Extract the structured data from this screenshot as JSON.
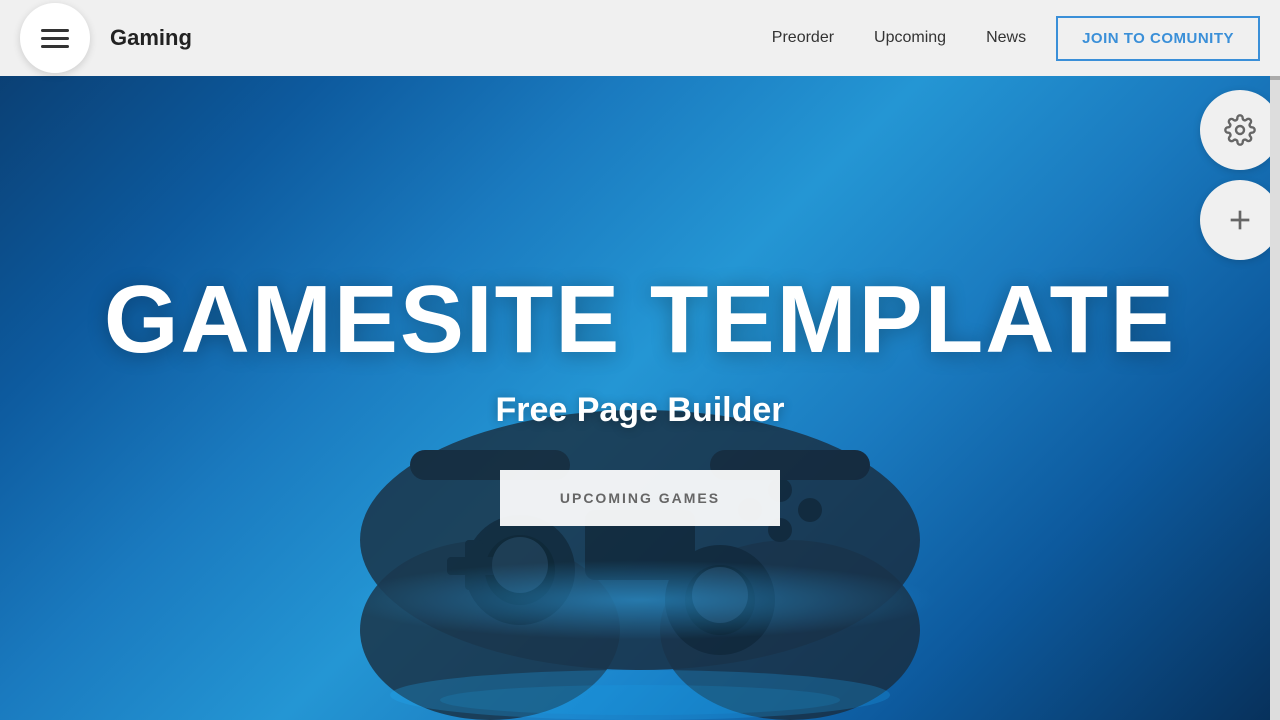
{
  "header": {
    "logo": "Gaming",
    "nav": {
      "preorder": "Preorder",
      "upcoming": "Upcoming",
      "news": "News",
      "join_button": "JOIN TO COMUNITY"
    }
  },
  "hero": {
    "title": "GAMESITE TEMPLATE",
    "subtitle": "Free Page Builder",
    "cta_button": "UPCOMING GAMES"
  },
  "floating": {
    "settings_icon": "gear-icon",
    "add_icon": "plus-icon"
  },
  "colors": {
    "accent_blue": "#3a8fd8",
    "bg_light": "#f0f0f0",
    "hero_bg_start": "#0a3a6b",
    "hero_bg_end": "#2496d4"
  }
}
